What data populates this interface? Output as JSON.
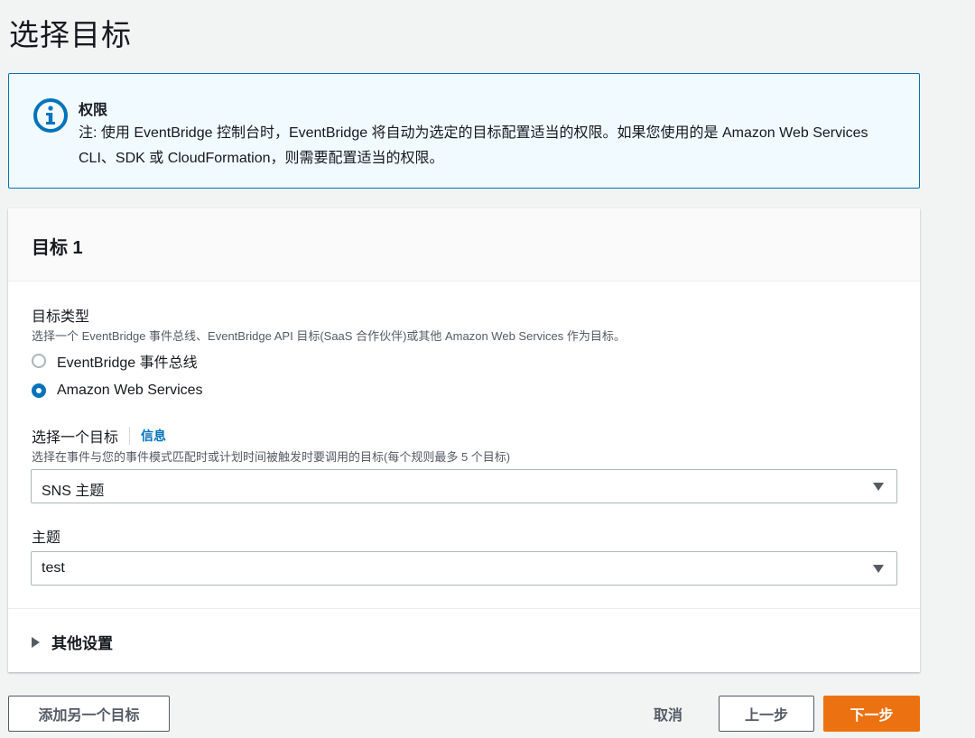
{
  "page": {
    "title": "选择目标"
  },
  "alert": {
    "icon": "info-icon",
    "title": "权限",
    "body": "注: 使用 EventBridge 控制台时，EventBridge 将自动为选定的目标配置适当的权限。如果您使用的是 Amazon Web Services CLI、SDK 或 CloudFormation，则需要配置适当的权限。",
    "border_color": "#0073bb",
    "background": "#f1faff"
  },
  "target": {
    "header": "目标 1",
    "type": {
      "label": "目标类型",
      "description": "选择一个 EventBridge 事件总线、EventBridge API 目标(SaaS 合作伙伴)或其他 Amazon Web Services 作为目标。",
      "options": [
        {
          "label": "EventBridge 事件总线",
          "selected": false
        },
        {
          "label": "Amazon Web Services",
          "selected": true
        }
      ]
    },
    "select_target": {
      "label": "选择一个目标",
      "info_link": "信息",
      "description": "选择在事件与您的事件模式匹配时或计划时间被触发时要调用的目标(每个规则最多 5 个目标)",
      "value": "SNS 主题"
    },
    "topic": {
      "label": "主题",
      "value": "test"
    },
    "additional_settings": "其他设置"
  },
  "footer": {
    "add_target": "添加另一个目标",
    "cancel": "取消",
    "previous": "上一步",
    "next": "下一步",
    "primary_color": "#ec7211"
  }
}
